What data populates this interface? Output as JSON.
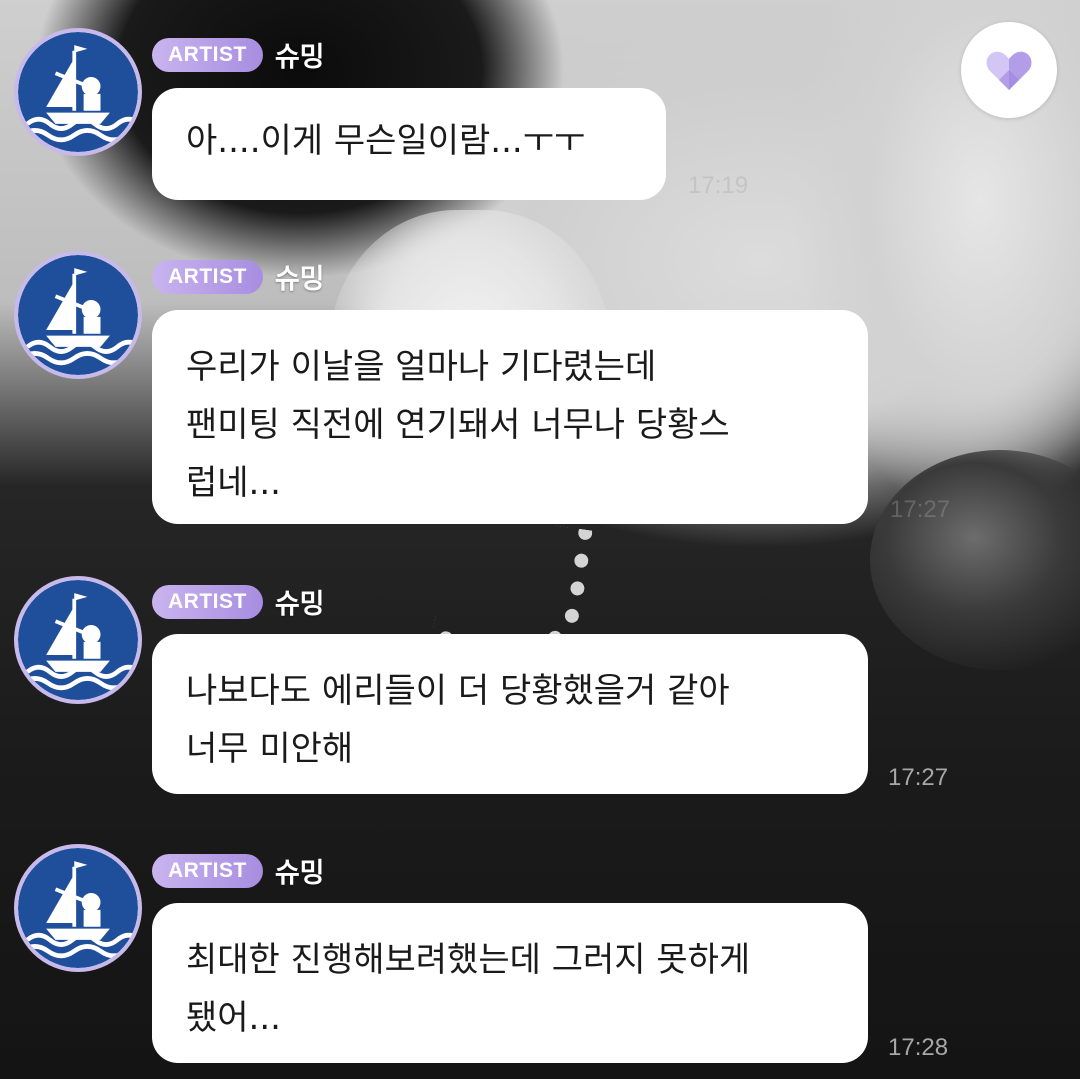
{
  "messages": [
    {
      "badge": "ARTIST",
      "sender": "슈밍",
      "text": "아....이게 무슨일이람...ㅜㅜ",
      "time": "17:19"
    },
    {
      "badge": "ARTIST",
      "sender": "슈밍",
      "text": "우리가 이날을 얼마나 기다렸는데\n팬미팅 직전에 연기돼서 너무나 당황스\n럽네...",
      "time": "17:27"
    },
    {
      "badge": "ARTIST",
      "sender": "슈밍",
      "text": "나보다도 에리들이 더 당황했을거 같아\n너무 미안해",
      "time": "17:27"
    },
    {
      "badge": "ARTIST",
      "sender": "슈밍",
      "text": "최대한 진행해보려했는데 그러지 못하게\n됐어...",
      "time": "17:28"
    }
  ],
  "icons": {
    "heart_button": "heart-icon",
    "avatar": "sailor-boat-avatar-icon"
  },
  "colors": {
    "badge_start": "#c9b4ef",
    "badge_end": "#a78de0",
    "heart": "#c2aef0",
    "avatar_ring": "#c7b9ea",
    "avatar_blue": "#1f4f9a"
  }
}
